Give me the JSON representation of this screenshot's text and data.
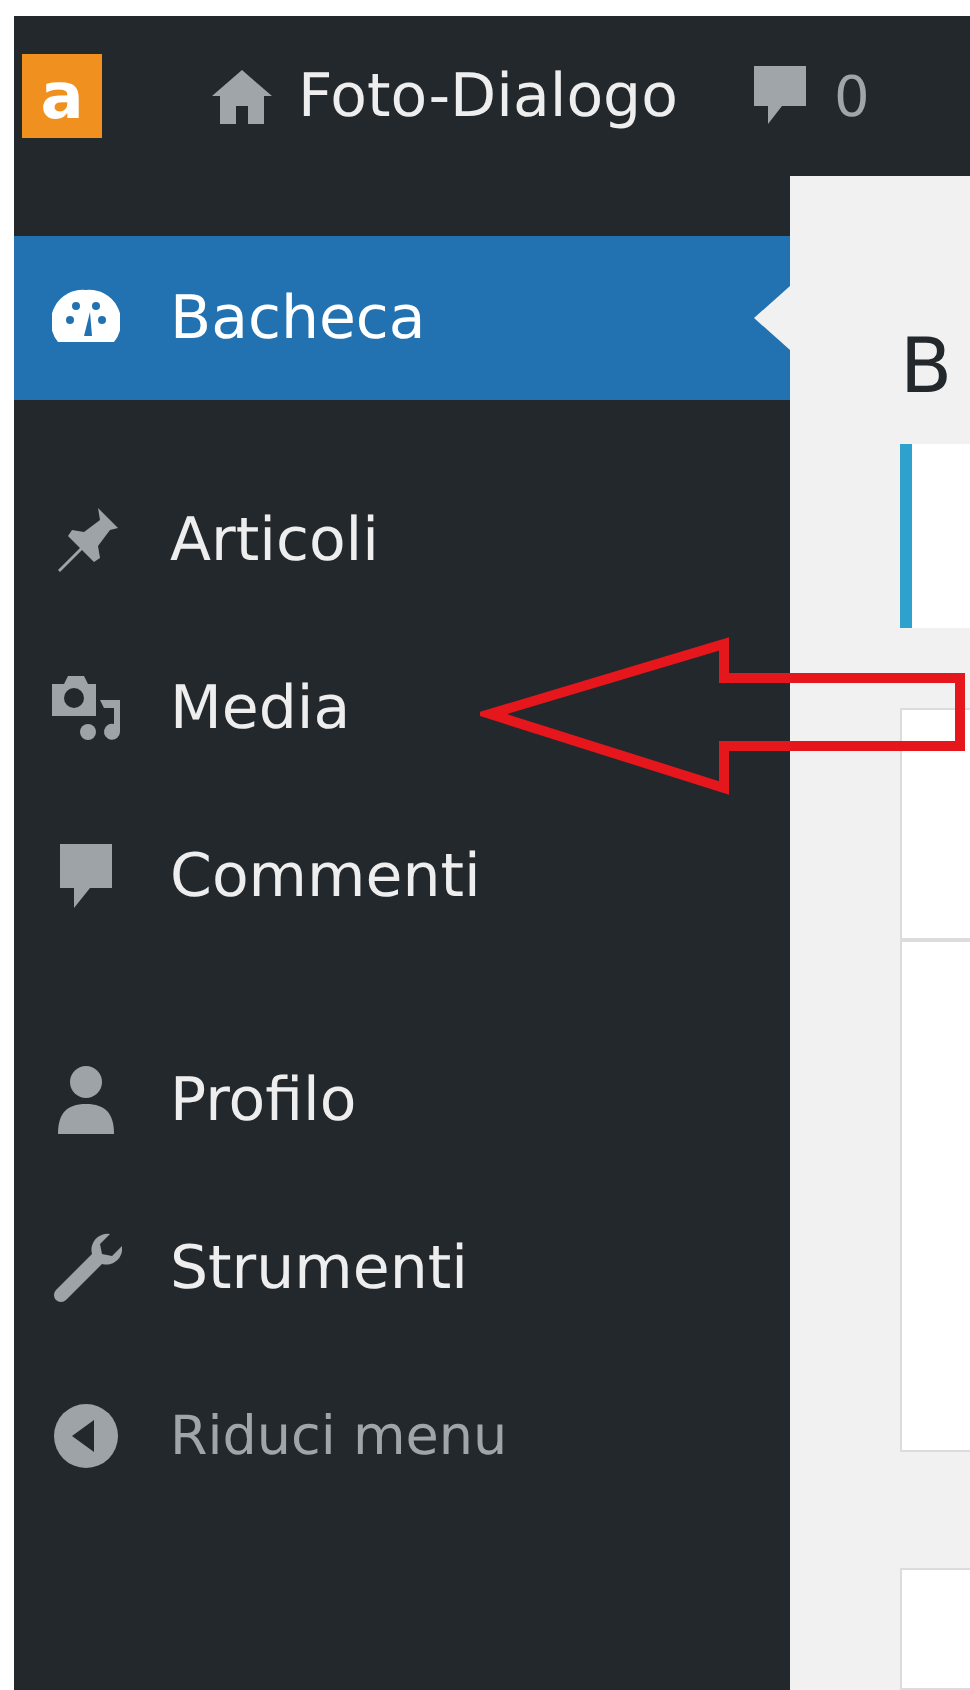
{
  "admin_bar": {
    "logo": "a",
    "site_name": "Foto-Dialogo",
    "comments_count": "0"
  },
  "sidebar": {
    "groups": [
      [
        {
          "label": "Bacheca",
          "kind": "item",
          "selected": true
        }
      ],
      [
        {
          "label": "Articoli",
          "kind": "item",
          "selected": false
        },
        {
          "label": "Media",
          "kind": "item",
          "selected": false
        },
        {
          "label": "Commenti",
          "kind": "item",
          "selected": false
        }
      ],
      [
        {
          "label": "Profilo",
          "kind": "item",
          "selected": false
        },
        {
          "label": "Strumenti",
          "kind": "item",
          "selected": false
        },
        {
          "label": "Riduci menu",
          "kind": "collapse",
          "selected": false
        }
      ]
    ]
  },
  "content": {
    "heading": "B"
  }
}
